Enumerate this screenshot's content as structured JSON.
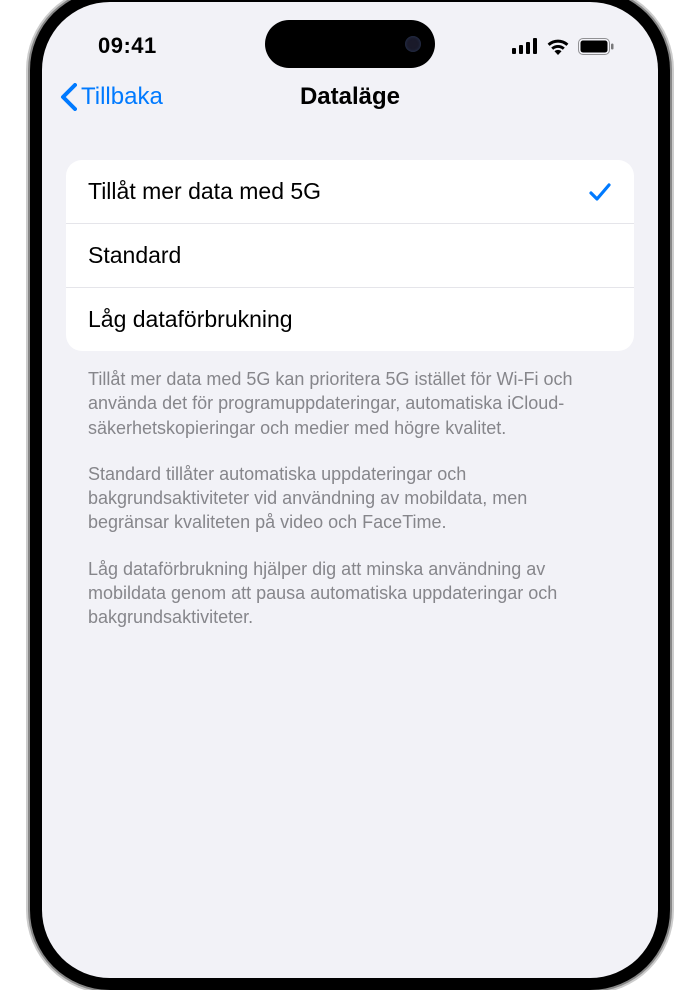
{
  "status": {
    "time": "09:41"
  },
  "nav": {
    "back_label": "Tillbaka",
    "title": "Dataläge"
  },
  "options": [
    {
      "label": "Tillåt mer data med 5G",
      "selected": true
    },
    {
      "label": "Standard",
      "selected": false
    },
    {
      "label": "Låg dataförbrukning",
      "selected": false
    }
  ],
  "footer": {
    "p1": "Tillåt mer data med 5G kan prioritera 5G istället för Wi-Fi och använda det för programuppdateringar, automatiska iCloud-säkerhetskopieringar och medier med högre kvalitet.",
    "p2": "Standard tillåter automatiska uppdateringar och bakgrundsaktiviteter vid användning av mobildata, men begränsar kvaliteten på video och FaceTime.",
    "p3": "Låg dataförbrukning hjälper dig att minska användning av mobildata genom att pausa automatiska uppdateringar och bakgrundsaktiviteter."
  },
  "colors": {
    "accent": "#007aff",
    "background": "#f2f2f7",
    "text_secondary": "#86868b"
  }
}
